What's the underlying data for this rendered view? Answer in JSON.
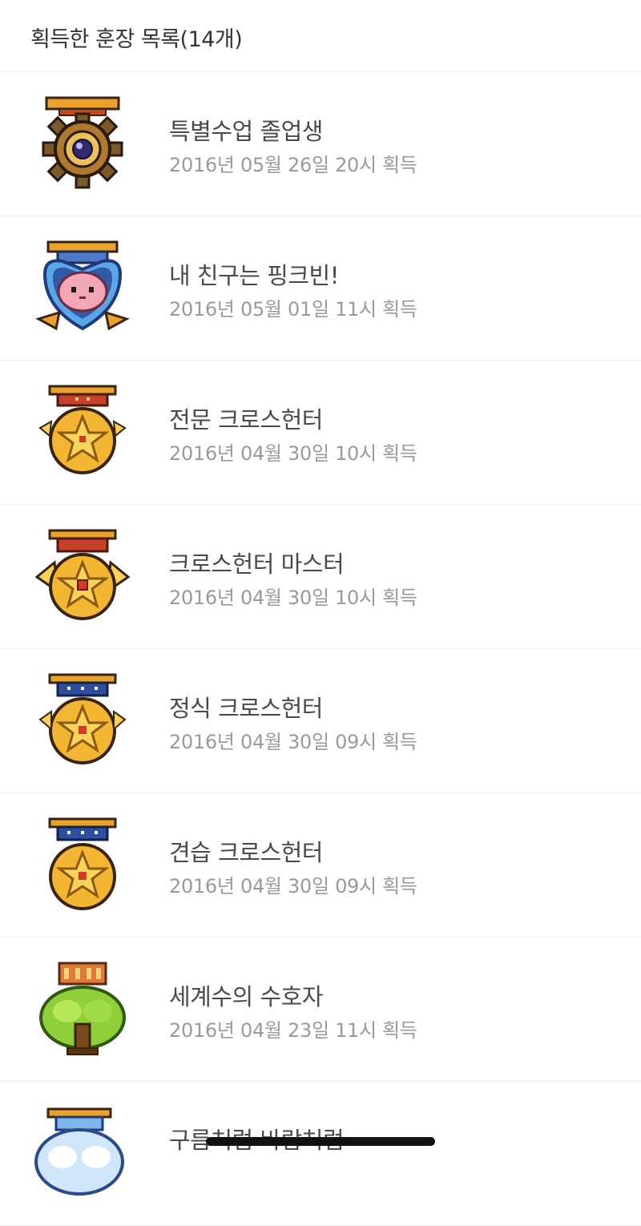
{
  "header": {
    "title": "획득한 훈장 목록(14개)"
  },
  "medals": [
    {
      "name": "특별수업 졸업생",
      "date": "2016년 05월 26일 20시 획득",
      "icon": "gear-medal-icon"
    },
    {
      "name": "내 친구는 핑크빈!",
      "date": "2016년 05월 01일 11시 획득",
      "icon": "pink-bean-medal-icon"
    },
    {
      "name": "전문 크로스헌터",
      "date": "2016년 04월 30일 10시 획득",
      "icon": "star-medal-icon"
    },
    {
      "name": "크로스헌터 마스터",
      "date": "2016년 04월 30일 10시 획득",
      "icon": "star-medal-winged-icon"
    },
    {
      "name": "정식 크로스헌터",
      "date": "2016년 04월 30일 09시 획득",
      "icon": "star-medal-blue-icon"
    },
    {
      "name": "견습 크로스헌터",
      "date": "2016년 04월 30일 09시 획득",
      "icon": "star-medal-blue-plain-icon"
    },
    {
      "name": "세계수의 수호자",
      "date": "2016년 04월 23일 11시 획득",
      "icon": "tree-medal-icon"
    },
    {
      "name": "구름처럼 바람처럼",
      "date": "",
      "icon": "cloud-medal-icon"
    }
  ],
  "colors": {
    "divider": "#ececec",
    "name": "#4a4a4a",
    "date": "#9a9a9a",
    "gold": "#f2b632",
    "red_ribbon": "#c6402a",
    "blue_ribbon": "#2d4f9e"
  }
}
